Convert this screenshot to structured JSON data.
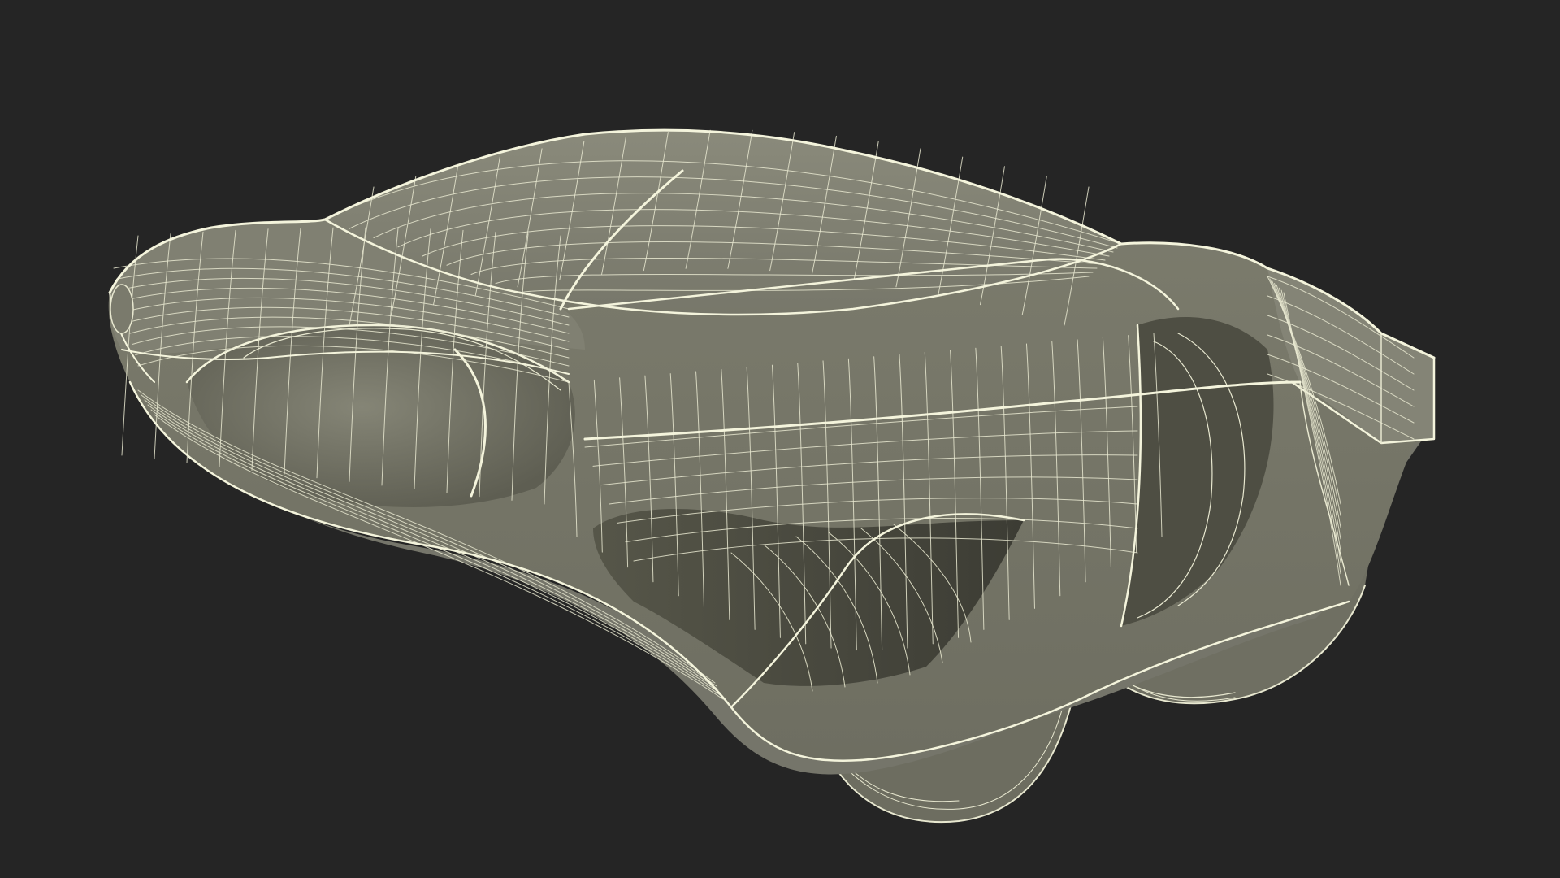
{
  "scene": {
    "subject_icon": "wireframe-vehicle-icon",
    "colors": {
      "background": "#252525",
      "body_fill": "#7c7c6d",
      "body_fill_light": "#8a8a7a",
      "shadow_fill": "#5a5a4e",
      "deep_shadow": "#3d3d35",
      "wire": "#e8e8d0",
      "wire_bright": "#f4f4dc"
    }
  }
}
